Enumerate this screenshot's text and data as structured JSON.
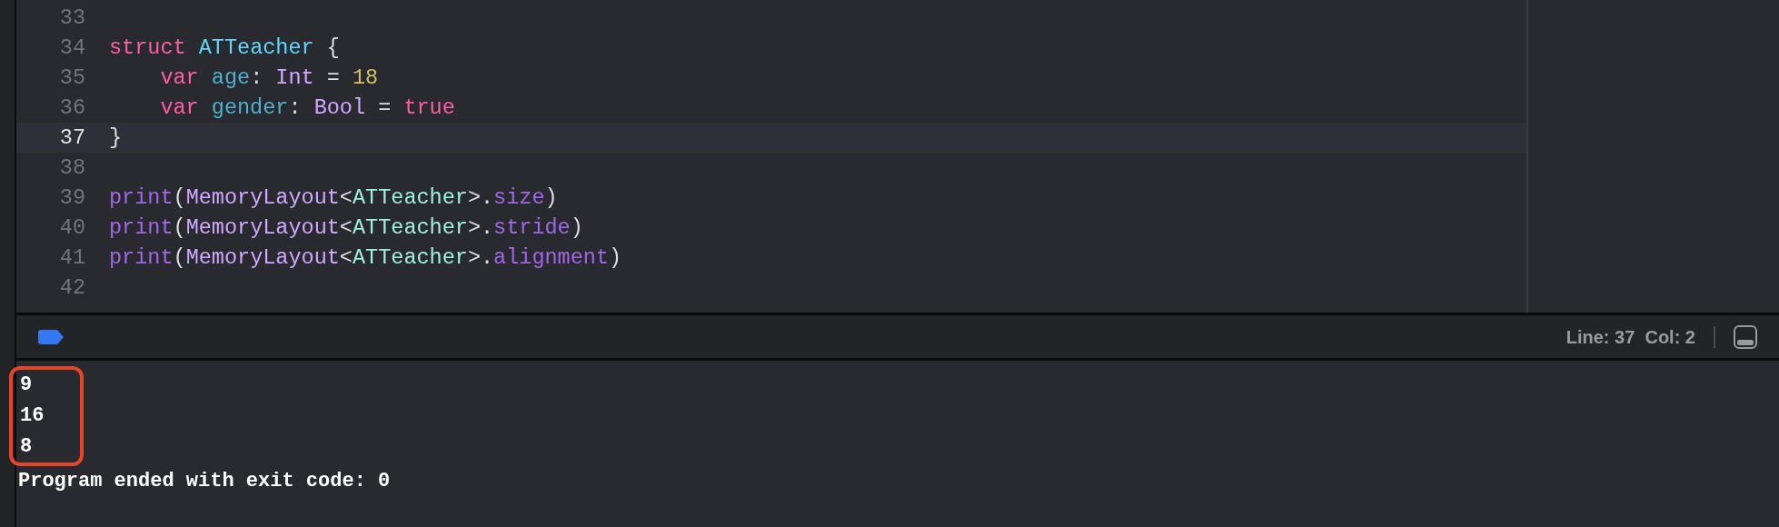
{
  "editor": {
    "lines": [
      {
        "number": "33",
        "current": false
      },
      {
        "number": "34",
        "current": false,
        "tokens": [
          {
            "kind": "keyword",
            "text": "struct "
          },
          {
            "kind": "type_decl",
            "text": "ATTeacher"
          },
          {
            "kind": "plain",
            "text": " {"
          }
        ]
      },
      {
        "number": "35",
        "current": false,
        "indented": true,
        "tokens": [
          {
            "kind": "keyword",
            "text": "var "
          },
          {
            "kind": "property_decl",
            "text": "age"
          },
          {
            "kind": "plain",
            "text": ": "
          },
          {
            "kind": "system_type",
            "text": "Int"
          },
          {
            "kind": "plain",
            "text": " = "
          },
          {
            "kind": "number",
            "text": "18"
          }
        ]
      },
      {
        "number": "36",
        "current": false,
        "indented": true,
        "tokens": [
          {
            "kind": "keyword",
            "text": "var "
          },
          {
            "kind": "property_decl",
            "text": "gender"
          },
          {
            "kind": "plain",
            "text": ": "
          },
          {
            "kind": "system_type",
            "text": "Bool"
          },
          {
            "kind": "plain",
            "text": " = "
          },
          {
            "kind": "keyword",
            "text": "true"
          }
        ]
      },
      {
        "number": "37",
        "current": true,
        "tokens": [
          {
            "kind": "plain",
            "text": "}"
          }
        ]
      },
      {
        "number": "38",
        "current": false
      },
      {
        "number": "39",
        "current": false,
        "tokens": [
          {
            "kind": "system_function",
            "text": "print"
          },
          {
            "kind": "plain",
            "text": "("
          },
          {
            "kind": "system_type",
            "text": "MemoryLayout"
          },
          {
            "kind": "plain",
            "text": "<"
          },
          {
            "kind": "project_type",
            "text": "ATTeacher"
          },
          {
            "kind": "plain",
            "text": ">."
          },
          {
            "kind": "system_function",
            "text": "size"
          },
          {
            "kind": "plain",
            "text": ")"
          }
        ]
      },
      {
        "number": "40",
        "current": false,
        "tokens": [
          {
            "kind": "system_function",
            "text": "print"
          },
          {
            "kind": "plain",
            "text": "("
          },
          {
            "kind": "system_type",
            "text": "MemoryLayout"
          },
          {
            "kind": "plain",
            "text": "<"
          },
          {
            "kind": "project_type",
            "text": "ATTeacher"
          },
          {
            "kind": "plain",
            "text": ">."
          },
          {
            "kind": "system_function",
            "text": "stride"
          },
          {
            "kind": "plain",
            "text": ")"
          }
        ]
      },
      {
        "number": "41",
        "current": false,
        "tokens": [
          {
            "kind": "system_function",
            "text": "print"
          },
          {
            "kind": "plain",
            "text": "("
          },
          {
            "kind": "system_type",
            "text": "MemoryLayout"
          },
          {
            "kind": "plain",
            "text": "<"
          },
          {
            "kind": "project_type",
            "text": "ATTeacher"
          },
          {
            "kind": "plain",
            "text": ">."
          },
          {
            "kind": "system_function",
            "text": "alignment"
          },
          {
            "kind": "plain",
            "text": ")"
          }
        ]
      },
      {
        "number": "42",
        "current": false
      }
    ]
  },
  "debug_bar": {
    "breakpoints_active": true,
    "position": "Line: 37  Col: 2"
  },
  "console": {
    "lines": [
      {
        "text": "9",
        "highlighted": true
      },
      {
        "text": "16",
        "highlighted": true
      },
      {
        "text": "8",
        "highlighted": true
      },
      {
        "text": "Program ended with exit code: 0",
        "highlighted": false
      }
    ]
  }
}
